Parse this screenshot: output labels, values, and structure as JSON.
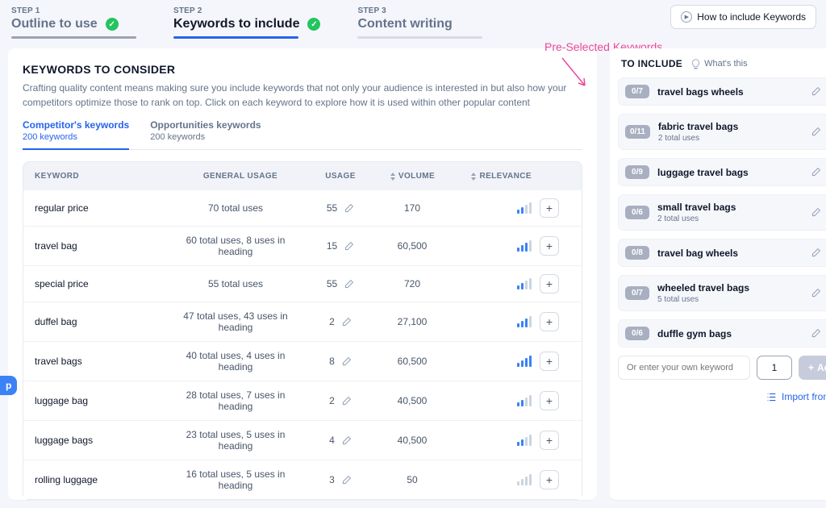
{
  "header": {
    "steps": [
      {
        "lbl": "STEP 1",
        "ttl": "Outline to use",
        "check": true,
        "underlineClass": "u-gray"
      },
      {
        "lbl": "STEP 2",
        "ttl": "Keywords to include",
        "check": true,
        "underlineClass": "u-blue",
        "active": true
      },
      {
        "lbl": "STEP 3",
        "ttl": "Content writing",
        "check": false,
        "underlineClass": "u-light"
      }
    ],
    "how_btn": "How to include Keywords"
  },
  "annotation": "Pre-Selected Keywords",
  "left": {
    "title": "KEYWORDS TO CONSIDER",
    "desc": "Crafting quality content means making sure you include keywords that not only your audience is interested in but also how your competitors optimize those to rank on top. Click on each keyword to explore how it is used within other popular content",
    "tabs": [
      {
        "t1": "Competitor's keywords",
        "t2": "200 keywords",
        "active": true
      },
      {
        "t1": "Opportunities keywords",
        "t2": "200 keywords"
      }
    ],
    "cols": {
      "c1": "KEYWORD",
      "c2": "GENERAL USAGE",
      "c3": "USAGE",
      "c4": "VOLUME",
      "c5": "RELEVANCE"
    },
    "rows": [
      {
        "kw": "regular price",
        "usg": "70 total uses",
        "cnt": "55",
        "vol": "170",
        "rel": 2
      },
      {
        "kw": "travel bag",
        "usg": "60 total uses, 8 uses in heading",
        "cnt": "15",
        "vol": "60,500",
        "rel": 3
      },
      {
        "kw": "special price",
        "usg": "55 total uses",
        "cnt": "55",
        "vol": "720",
        "rel": 2
      },
      {
        "kw": "duffel bag",
        "usg": "47 total uses, 43 uses in heading",
        "cnt": "2",
        "vol": "27,100",
        "rel": 3
      },
      {
        "kw": "travel bags",
        "usg": "40 total uses, 4 uses in heading",
        "cnt": "8",
        "vol": "60,500",
        "rel": 4
      },
      {
        "kw": "luggage bag",
        "usg": "28 total uses, 7 uses in heading",
        "cnt": "2",
        "vol": "40,500",
        "rel": 2
      },
      {
        "kw": "luggage bags",
        "usg": "23 total uses, 5 uses in heading",
        "cnt": "4",
        "vol": "40,500",
        "rel": 2
      },
      {
        "kw": "rolling luggage",
        "usg": "16 total uses, 5 uses in heading",
        "cnt": "3",
        "vol": "50",
        "rel": 0
      }
    ]
  },
  "right": {
    "title": "TO INCLUDE",
    "whats": "What's this",
    "items": [
      {
        "badge": "0/7",
        "name": "travel bags wheels",
        "sub": ""
      },
      {
        "badge": "0/11",
        "name": "fabric travel bags",
        "sub": "2 total uses"
      },
      {
        "badge": "0/9",
        "name": "luggage travel bags",
        "sub": ""
      },
      {
        "badge": "0/6",
        "name": "small travel bags",
        "sub": "2 total uses"
      },
      {
        "badge": "0/8",
        "name": "travel bag wheels",
        "sub": ""
      },
      {
        "badge": "0/7",
        "name": "wheeled travel bags",
        "sub": "5 total uses"
      },
      {
        "badge": "0/6",
        "name": "duffle gym bags",
        "sub": ""
      }
    ],
    "placeholder": "Or enter your own keyword",
    "num": "1",
    "add": "Add",
    "import": "Import from list"
  }
}
